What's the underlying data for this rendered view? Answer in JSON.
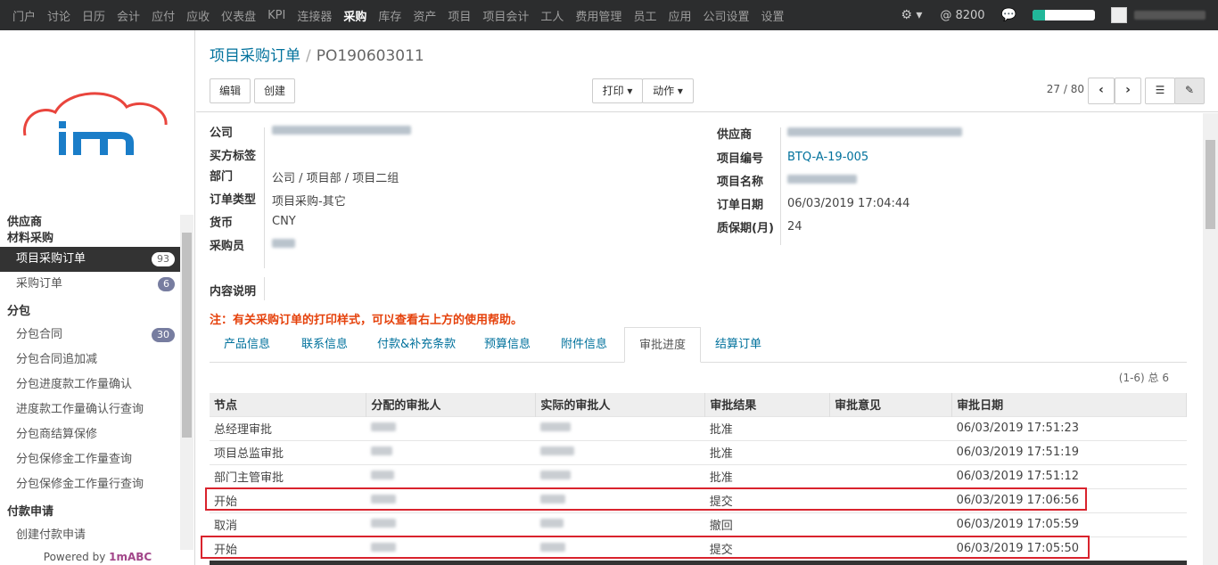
{
  "topbar": {
    "menu": [
      "门户",
      "讨论",
      "日历",
      "会计",
      "应付",
      "应收",
      "仪表盘",
      "KPI",
      "连接器",
      "采购",
      "库存",
      "资产",
      "项目",
      "项目会计",
      "工人",
      "费用管理",
      "员工",
      "应用",
      "公司设置",
      "设置"
    ],
    "active_menu": "采购",
    "at_count": "@ 8200",
    "progress_fraction": 0.2
  },
  "sidebar": {
    "powered_prefix": "Powered by ",
    "powered_brand": "1mABC",
    "sections": [
      {
        "title": "供应商",
        "items": []
      },
      {
        "title": "材料采购",
        "items": [
          {
            "label": "项目采购订单",
            "badge": "93",
            "active": true
          },
          {
            "label": "采购订单",
            "badge": "6",
            "active": false
          }
        ]
      },
      {
        "title": "分包",
        "items": [
          {
            "label": "分包合同",
            "badge": "30",
            "active": false
          },
          {
            "label": "分包合同追加减",
            "badge": "",
            "active": false
          },
          {
            "label": "分包进度款工作量确认",
            "badge": "",
            "active": false
          },
          {
            "label": "进度款工作量确认行查询",
            "badge": "",
            "active": false
          },
          {
            "label": "分包商结算保修",
            "badge": "",
            "active": false
          },
          {
            "label": "分包保修金工作量查询",
            "badge": "",
            "active": false
          },
          {
            "label": "分包保修金工作量行查询",
            "badge": "",
            "active": false
          }
        ]
      },
      {
        "title": "付款申请",
        "items": [
          {
            "label": "创建付款申请",
            "badge": "",
            "active": false
          }
        ]
      }
    ]
  },
  "breadcrumb": {
    "link": "项目采购订单",
    "sep": "/",
    "current": "PO190603011"
  },
  "buttons": {
    "edit": "编辑",
    "create": "创建",
    "print": "打印",
    "action": "动作"
  },
  "pager": "27 / 80",
  "form": {
    "left": [
      {
        "label": "公司",
        "value": ""
      },
      {
        "label": "买方标签",
        "value": ""
      },
      {
        "label": "部门",
        "value": "公司 / 项目部 / 项目二组"
      },
      {
        "label": "订单类型",
        "value": "项目采购-其它"
      },
      {
        "label": "货币",
        "value": "CNY"
      },
      {
        "label": "采购员",
        "value": ""
      }
    ],
    "right": [
      {
        "label": "供应商",
        "value": ""
      },
      {
        "label": "项目编号",
        "value": "BTQ-A-19-005"
      },
      {
        "label": "项目名称",
        "value": ""
      },
      {
        "label": "订单日期",
        "value": "06/03/2019 17:04:44"
      },
      {
        "label": "质保期(月)",
        "value": "24"
      }
    ],
    "description_label": "内容说明",
    "note": "注：有关采购订单的打印样式，可以查看右上方的使用帮助。"
  },
  "tabs": [
    "产品信息",
    "联系信息",
    "付款&补充条款",
    "预算信息",
    "附件信息",
    "审批进度",
    "结算订单"
  ],
  "active_tab": "审批进度",
  "list_count": "(1-6) 总 6",
  "table": {
    "columns": [
      "节点",
      "分配的审批人",
      "实际的审批人",
      "审批结果",
      "审批意见",
      "审批日期"
    ],
    "rows": [
      {
        "node": "总经理审批",
        "result": "批准",
        "date": "06/03/2019 17:51:23"
      },
      {
        "node": "项目总监审批",
        "result": "批准",
        "date": "06/03/2019 17:51:19"
      },
      {
        "node": "部门主管审批",
        "result": "批准",
        "date": "06/03/2019 17:51:12"
      },
      {
        "node": "开始",
        "result": "提交",
        "date": "06/03/2019 17:06:56"
      },
      {
        "node": "取消",
        "result": "撤回",
        "date": "06/03/2019 17:05:59"
      },
      {
        "node": "开始",
        "result": "提交",
        "date": "06/03/2019 17:05:50"
      }
    ]
  }
}
